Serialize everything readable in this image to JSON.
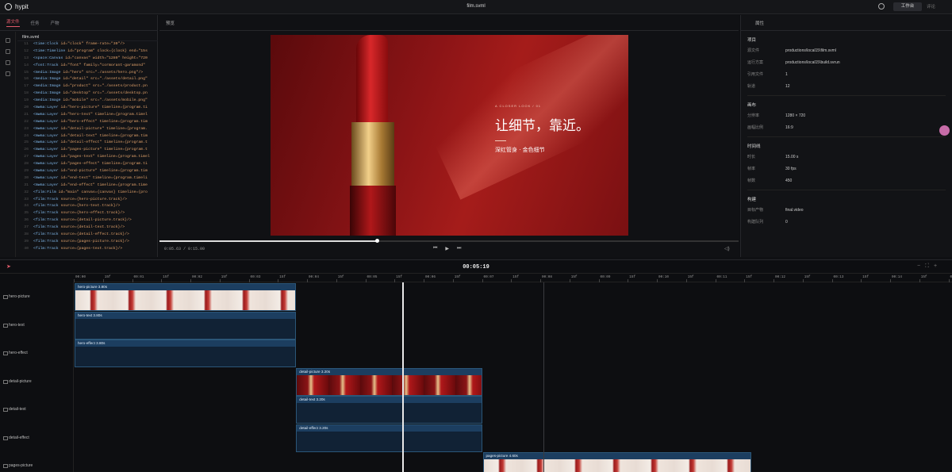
{
  "app": {
    "name": "hypit",
    "file_title": "film.svml",
    "workbench_label": "工作台",
    "comment_label": "评论"
  },
  "source": {
    "tabs": [
      {
        "label": "源文件"
      },
      {
        "label": "任务"
      },
      {
        "label": "产物"
      }
    ],
    "file_name": "film.svml",
    "lines": [
      {
        "n": "11",
        "tag": "<time:Clock",
        "rest": " id=\"clock\" frame-rate=\"30\"/>"
      },
      {
        "n": "12",
        "tag": "<time:Timeline",
        "rest": " id=\"program\" clock={clock} end=\"15s"
      },
      {
        "n": "13",
        "tag": "<space:Canvas",
        "rest": " id=\"canvas\" width=\"1280\" height=\"720"
      },
      {
        "n": "14",
        "tag": "<font:Track",
        "rest": " id=\"font\" family=\"cormorant-garamond\""
      },
      {
        "n": "15",
        "tag": "<media:Image",
        "rest": " id=\"hero\" src=\"./assets/hero.png\"/>"
      },
      {
        "n": "16",
        "tag": "<media:Image",
        "rest": " id=\"detail\" src=\"./assets/detail.png\""
      },
      {
        "n": "17",
        "tag": "<media:Image",
        "rest": " id=\"product\" src=\"./assets/product.pn"
      },
      {
        "n": "18",
        "tag": "<media:Image",
        "rest": " id=\"desktop\" src=\"./assets/desktop.pn"
      },
      {
        "n": "19",
        "tag": "<media:Image",
        "rest": " id=\"mobile\" src=\"./assets/mobile.png\""
      },
      {
        "n": "20",
        "tag": "<mwma:Layer",
        "rest": " id=\"hero-picture\" timeline={program.ti"
      },
      {
        "n": "21",
        "tag": "<mwma:Layer",
        "rest": " id=\"hero-text\" timeline={program.timel"
      },
      {
        "n": "22",
        "tag": "<mwma:Layer",
        "rest": " id=\"hero-effect\" timeline={program.tim"
      },
      {
        "n": "23",
        "tag": "<mwma:Layer",
        "rest": " id=\"detail-picture\" timeline={program."
      },
      {
        "n": "24",
        "tag": "<mwma:Layer",
        "rest": " id=\"detail-text\" timeline={program.tim"
      },
      {
        "n": "25",
        "tag": "<mwma:Layer",
        "rest": " id=\"detail-effect\" timeline={program.t"
      },
      {
        "n": "26",
        "tag": "<mwma:Layer",
        "rest": " id=\"pages-picture\" timeline={program.t"
      },
      {
        "n": "27",
        "tag": "<mwma:Layer",
        "rest": " id=\"pages-text\" timeline={program.timel"
      },
      {
        "n": "28",
        "tag": "<mwma:Layer",
        "rest": " id=\"pages-effect\" timeline={program.ti"
      },
      {
        "n": "29",
        "tag": "<mwma:Layer",
        "rest": " id=\"end-picture\" timeline={program.tim"
      },
      {
        "n": "30",
        "tag": "<mwma:Layer",
        "rest": " id=\"end-text\" timeline={program.timeli"
      },
      {
        "n": "31",
        "tag": "<mwma:Layer",
        "rest": " id=\"end-effect\" timeline={program.time"
      },
      {
        "n": "32",
        "tag": "<film:Film",
        "rest": " id=\"main\" canvas={canvas} timeline={pro"
      },
      {
        "n": "33",
        "tag": "<film:Track",
        "rest": " source={hero-picture.track}/>"
      },
      {
        "n": "34",
        "tag": "<film:Track",
        "rest": " source={hero-text.track}/>"
      },
      {
        "n": "35",
        "tag": "<film:Track",
        "rest": " source={hero-effect.track}/>"
      },
      {
        "n": "36",
        "tag": "<film:Track",
        "rest": " source={detail-picture.track}/>"
      },
      {
        "n": "37",
        "tag": "<film:Track",
        "rest": " source={detail-text.track}/>"
      },
      {
        "n": "38",
        "tag": "<film:Track",
        "rest": " source={detail-effect.track}/>"
      },
      {
        "n": "39",
        "tag": "<film:Track",
        "rest": " source={pages-picture.track}/>"
      },
      {
        "n": "40",
        "tag": "<film:Track",
        "rest": " source={pages-text.track}/>"
      }
    ]
  },
  "preview": {
    "header": "预览",
    "subtitle": "A CLOSER LOOK / 01",
    "headline": "让细节，靠近。",
    "tagline": "深红管身 · 金色细节",
    "timecode": "0:05.63 / 0:15.00",
    "progress": 0.375
  },
  "properties": {
    "header": "属性",
    "sections": [
      {
        "title": "项目",
        "rows": [
          {
            "k": "源文件",
            "v": "productions\\local15\\film.svml"
          },
          {
            "k": "运行方案",
            "v": "productions\\local15\\build.svrun"
          },
          {
            "k": "引用文件",
            "v": "1"
          },
          {
            "k": "轨道",
            "v": "12"
          }
        ]
      },
      {
        "title": "画布",
        "rows": [
          {
            "k": "分辨率",
            "v": "1280 × 720"
          },
          {
            "k": "画幅比例",
            "v": "16:9"
          }
        ]
      },
      {
        "title": "时间线",
        "rows": [
          {
            "k": "时长",
            "v": "15.00 s"
          },
          {
            "k": "帧率",
            "v": "30 fps"
          },
          {
            "k": "帧数",
            "v": "450"
          }
        ]
      },
      {
        "title": "构建",
        "rows": [
          {
            "k": "目标产物",
            "v": "final.video"
          },
          {
            "k": "构建队列",
            "v": "0"
          }
        ]
      }
    ]
  },
  "timeline": {
    "current_time": "00:05:19",
    "ticks": [
      "00:00",
      "15f",
      "00:01",
      "15f",
      "00:02",
      "15f",
      "00:03",
      "15f",
      "00:04",
      "15f",
      "00:05",
      "15f",
      "00:06",
      "15f",
      "00:07",
      "15f",
      "00:08",
      "15f",
      "00:09",
      "15f",
      "00:10",
      "15f",
      "00:11",
      "15f",
      "00:12",
      "15f",
      "00:13",
      "15f",
      "00:14",
      "15f",
      "00:15"
    ],
    "tracks": [
      "hero-picture",
      "hero-text",
      "hero-effect",
      "detail-picture",
      "detail-text",
      "detail-effect",
      "pages-picture"
    ],
    "clips": [
      {
        "label": "hero-picture 3.80s",
        "track": 0,
        "start": 0,
        "dur": 3.8,
        "kind": "pic"
      },
      {
        "label": "hero-text 3.80s",
        "track": 1,
        "start": 0,
        "dur": 3.8,
        "kind": "txt"
      },
      {
        "label": "hero-effect 3.80s",
        "track": 2,
        "start": 0,
        "dur": 3.8,
        "kind": "txt"
      },
      {
        "label": "detail-picture 3.20s",
        "track": 3,
        "start": 3.8,
        "dur": 3.2,
        "kind": "red"
      },
      {
        "label": "detail-text 3.20s",
        "track": 4,
        "start": 3.8,
        "dur": 3.2,
        "kind": "txt"
      },
      {
        "label": "detail-effect 3.20s",
        "track": 5,
        "start": 3.8,
        "dur": 3.2,
        "kind": "txt"
      },
      {
        "label": "pages-picture 4.60s",
        "track": 6,
        "start": 7.0,
        "dur": 4.6,
        "kind": "pic"
      }
    ],
    "playhead_s": 5.63
  }
}
